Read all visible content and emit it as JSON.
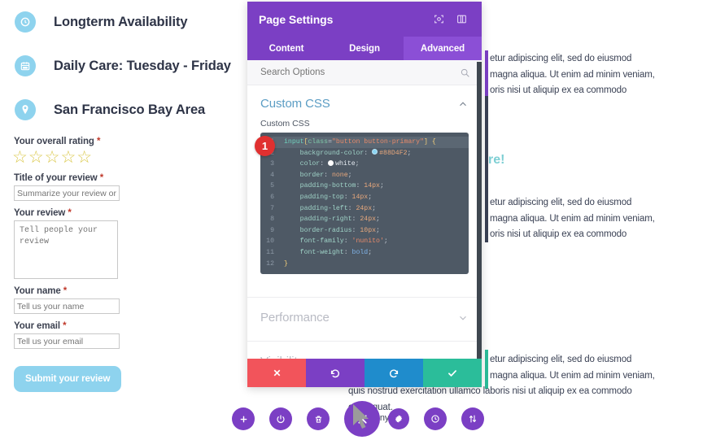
{
  "page": {
    "features": [
      {
        "icon": "clock-icon",
        "label": "Longterm Availability"
      },
      {
        "icon": "calendar-icon",
        "label": "Daily Care: Tuesday - Friday"
      },
      {
        "icon": "map-pin-icon",
        "label": "San Francisco Bay Area"
      }
    ],
    "review_form": {
      "rating_label": "Your overall rating",
      "required_mark": "*",
      "stars": "☆☆☆☆☆",
      "star_count": 5,
      "title_label": "Title of your review",
      "title_placeholder": "Summarize your review or hi",
      "review_label": "Your review",
      "review_placeholder": "Tell people your review",
      "name_label": "Your name",
      "name_placeholder": "Tell us your name",
      "email_label": "Your email",
      "email_placeholder": "Tell us your email",
      "submit_label": "Submit your review",
      "submit_color": "#8ed3ee"
    },
    "teal_heading_fragment": "re!",
    "lorem_blocks": [
      {
        "lines": [
          "etur adipiscing elit, sed do eiusmod",
          "magna aliqua. Ut enim ad minim veniam,",
          "oris nisi ut aliquip ex ea commodo"
        ],
        "accent_color": "#7b3fc4"
      },
      {
        "lines": [
          "etur adipiscing elit, sed do eiusmod",
          "magna aliqua. Ut enim ad minim veniam,",
          "oris nisi ut aliquip ex ea commodo"
        ],
        "accent_color": "#3a4154"
      },
      {
        "lines": [
          "etur adipiscing elit, sed do eiusmod",
          "magna aliqua. Ut enim ad minim veniam,",
          "quis nostrud exercitation ullamco laboris nisi ut aliquip ex ea commodo",
          "consequat."
        ],
        "accent_color": "#2bbd9a"
      }
    ],
    "obscured_word": "nony"
  },
  "modal": {
    "title": "Page Settings",
    "header_icons": [
      {
        "name": "focus-icon"
      },
      {
        "name": "layout-panel-icon"
      }
    ],
    "tabs": [
      {
        "label": "Content",
        "active": false
      },
      {
        "label": "Design",
        "active": false
      },
      {
        "label": "Advanced",
        "active": true
      }
    ],
    "search": {
      "placeholder": "Search Options",
      "value": "",
      "icon": "search-icon"
    },
    "sections": [
      {
        "name": "Custom CSS",
        "expanded": true
      },
      {
        "name": "Performance",
        "expanded": false
      },
      {
        "name": "Visibility",
        "expanded": false
      }
    ],
    "custom_css": {
      "section_title": "Custom CSS",
      "field_label": "Custom CSS",
      "marker_badge": "1",
      "lines": [
        {
          "n": "1",
          "text": "input[class=\"button button-primary\"] {"
        },
        {
          "n": "2",
          "text": "    background-color: #88D4F2;"
        },
        {
          "n": "3",
          "text": "    color: white;"
        },
        {
          "n": "4",
          "text": "    border: none;"
        },
        {
          "n": "5",
          "text": "    padding-bottom: 14px;"
        },
        {
          "n": "6",
          "text": "    padding-top: 14px;"
        },
        {
          "n": "7",
          "text": "    padding-left: 24px;"
        },
        {
          "n": "8",
          "text": "    padding-right: 24px;"
        },
        {
          "n": "9",
          "text": "    border-radius: 10px;"
        },
        {
          "n": "10",
          "text": "    font-family: 'nunito';"
        },
        {
          "n": "11",
          "text": "    font-weight: bold;"
        },
        {
          "n": "12",
          "text": "}"
        }
      ],
      "swatch_colors": [
        "#88D4F2",
        "#FFFFFF"
      ]
    },
    "performance_label": "Performance",
    "action_buttons": [
      {
        "name": "cancel-button",
        "icon": "x-icon",
        "color": "#f2545b"
      },
      {
        "name": "undo-button",
        "icon": "undo-icon",
        "color": "#7b3fc4"
      },
      {
        "name": "redo-button",
        "icon": "redo-icon",
        "color": "#1f8ccc"
      },
      {
        "name": "save-button",
        "icon": "check-icon",
        "color": "#2bbd9a"
      }
    ]
  },
  "bottom_toolbar": {
    "buttons": [
      {
        "name": "add-button",
        "icon": "plus-icon"
      },
      {
        "name": "power-button",
        "icon": "power-icon"
      },
      {
        "name": "trash-button",
        "icon": "trash-icon"
      },
      {
        "name": "close-button",
        "icon": "x-icon"
      },
      {
        "name": "settings-button",
        "icon": "gear-icon"
      },
      {
        "name": "history-button",
        "icon": "clock-icon"
      },
      {
        "name": "sort-button",
        "icon": "sort-icon"
      }
    ],
    "accent_color": "#7b3fc4"
  }
}
